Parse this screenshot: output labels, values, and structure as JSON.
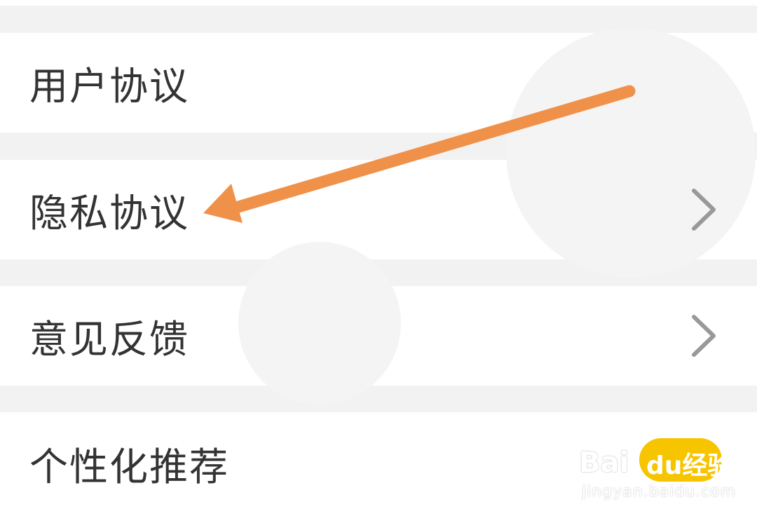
{
  "settings_list": {
    "items": [
      {
        "label": "用户协议",
        "has_chevron": true
      },
      {
        "label": "隐私协议",
        "has_chevron": true
      },
      {
        "label": "意见反馈",
        "has_chevron": true
      },
      {
        "label": "个性化推荐",
        "has_chevron": false
      }
    ]
  },
  "annotation": {
    "arrow_color": "#f0914a",
    "icon": "arrow-annotation-icon"
  },
  "watermark": {
    "logo_text": "Bai",
    "badge_text": "du经验",
    "url_text": "jingyan.baidu.com",
    "badge_color": "#f7c400"
  },
  "colors": {
    "background": "#f2f2f2",
    "card": "#ffffff",
    "text": "#333333",
    "chevron": "#999999"
  }
}
